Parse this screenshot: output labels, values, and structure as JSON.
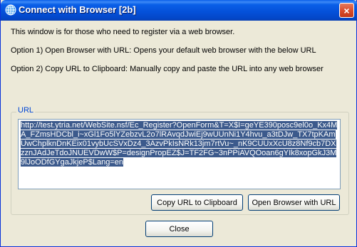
{
  "window": {
    "title": "Connect with Browser [2b]",
    "close_glyph": "×"
  },
  "intro": "This window is for those who need to register via a web browser.",
  "option1": "Option 1) Open Browser with URL: Opens your default web browser with the below URL",
  "option2": "Option 2) Copy URL to Clipboard: Manually copy and paste the URL into any web browser",
  "url_group": {
    "label": "URL",
    "value": "http://test.ytria.net/WebSite.nsf/Ec_Register?OpenForm&T=X$I=geYE390posc9el0o_Kx4MA_FZmsHDCbl_i~xGl1Fo5lYZebzvL2o7lRAvqdJwiEj9wUUnNi1Y4hvu_a3tDJw_TX7tpKAmUwChplknDnKEix01vybUcSVxDz4_3AzvPkIsNRk13jm7rtVu~_nK9CUUxXcU8z8Nf9cb7DXzznJAdJeTdoJNUEVDwW$P=designPropEZ$J=TF2FG~3nPPiAVQOoan6gYIk8xopGkJ3M9lJoODfGYgaJkjeP$Lang=en"
  },
  "buttons": {
    "copy": "Copy URL to Clipboard",
    "open": "Open Browser with URL",
    "close": "Close"
  },
  "icons": {
    "title": "globe-icon",
    "close": "close-icon"
  },
  "colors": {
    "titlebar": "#0a5fe8",
    "window_bg": "#ece9d8",
    "selection": "#3c5a8c",
    "group_label": "#0046d5"
  }
}
